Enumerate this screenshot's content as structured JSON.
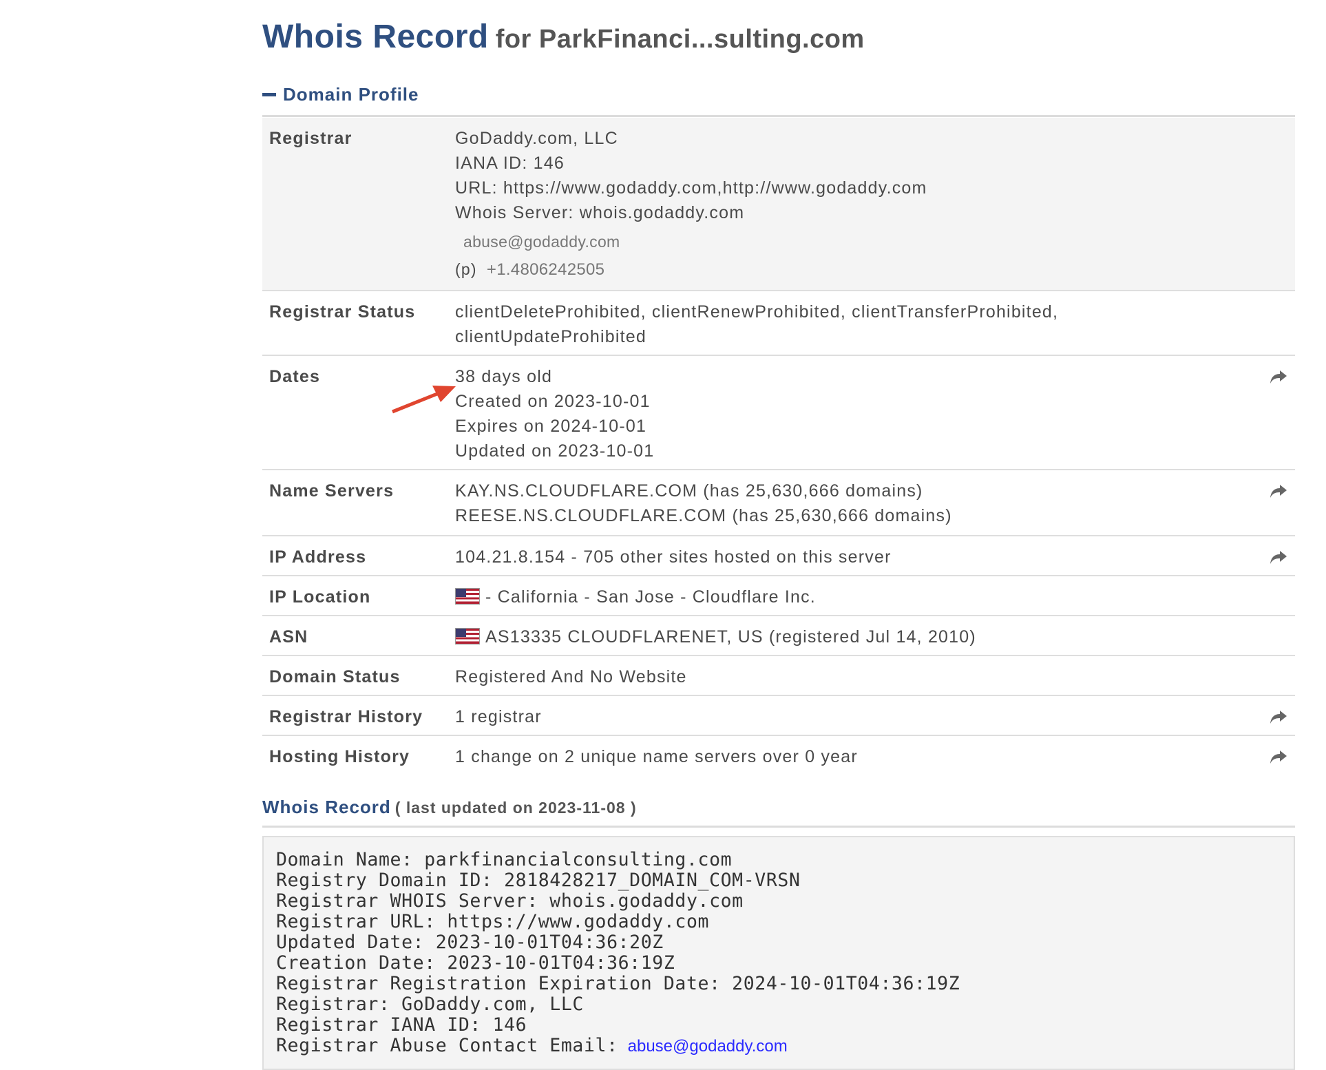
{
  "header": {
    "title": "Whois Record",
    "subtitle": "for ParkFinanci...sulting.com"
  },
  "profile": {
    "section_title": "Domain Profile",
    "registrar": {
      "label": "Registrar",
      "lines": [
        "GoDaddy.com, LLC",
        "IANA ID: 146",
        "URL: https://www.godaddy.com,http://www.godaddy.com",
        "Whois Server: whois.godaddy.com"
      ],
      "email": "abuse@godaddy.com",
      "phone_prefix": "(p)",
      "phone": "+1.4806242505"
    },
    "registrar_status": {
      "label": "Registrar Status",
      "lines": [
        "clientDeleteProhibited, clientRenewProhibited, clientTransferProhibited,",
        "clientUpdateProhibited"
      ]
    },
    "dates": {
      "label": "Dates",
      "lines": [
        "38 days old",
        "Created on 2023-10-01",
        "Expires on 2024-10-01",
        "Updated on 2023-10-01"
      ]
    },
    "name_servers": {
      "label": "Name Servers",
      "lines": [
        "KAY.NS.CLOUDFLARE.COM (has 25,630,666 domains)",
        "REESE.NS.CLOUDFLARE.COM (has 25,630,666 domains)"
      ]
    },
    "ip_address": {
      "label": "IP Address",
      "value": "104.21.8.154 - 705 other sites hosted on this server"
    },
    "ip_location": {
      "label": "IP Location",
      "value": "- California - San Jose - Cloudflare Inc."
    },
    "asn": {
      "label": "ASN",
      "value": "AS13335 CLOUDFLARENET, US (registered Jul 14, 2010)"
    },
    "domain_status": {
      "label": "Domain Status",
      "value": "Registered And No Website"
    },
    "registrar_history": {
      "label": "Registrar History",
      "value": "1 registrar"
    },
    "hosting_history": {
      "label": "Hosting History",
      "value": "1 change on 2 unique name servers over 0 year"
    }
  },
  "whois_record": {
    "title": "Whois Record",
    "updated": "( last updated on 2023-11-08 )",
    "lines": [
      "Domain Name: parkfinancialconsulting.com",
      "Registry Domain ID: 2818428217_DOMAIN_COM-VRSN",
      "Registrar WHOIS Server: whois.godaddy.com",
      "Registrar URL: https://www.godaddy.com",
      "Updated Date: 2023-10-01T04:36:20Z",
      "Creation Date: 2023-10-01T04:36:19Z",
      "Registrar Registration Expiration Date: 2024-10-01T04:36:19Z",
      "Registrar: GoDaddy.com, LLC",
      "Registrar IANA ID: 146"
    ],
    "abuse_label": "Registrar Abuse Contact Email:",
    "abuse_email": "abuse@godaddy.com"
  },
  "colors": {
    "title_blue": "#2f4f80",
    "annotation_arrow": "#e0452f",
    "link_blue": "#2a2aff"
  },
  "icons": {
    "share": "share-arrow-icon",
    "collapse": "minus-icon",
    "flag": "us-flag-icon"
  }
}
